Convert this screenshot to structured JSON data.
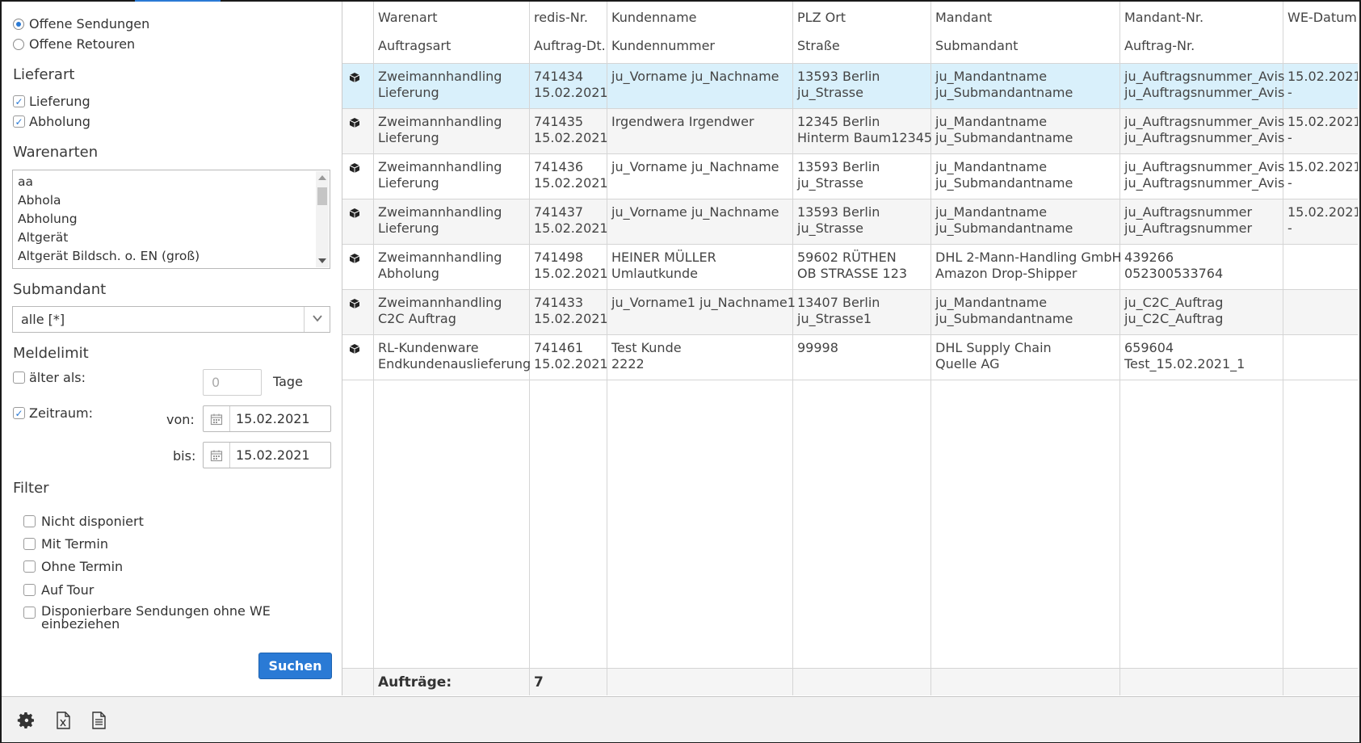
{
  "sidebar": {
    "status_options": [
      {
        "label": "Offene Sendungen",
        "selected": true
      },
      {
        "label": "Offene Retouren",
        "selected": false
      }
    ],
    "lieferart": {
      "title": "Lieferart",
      "options": [
        {
          "label": "Lieferung",
          "checked": true
        },
        {
          "label": "Abholung",
          "checked": true
        }
      ]
    },
    "warenarten": {
      "title": "Warenarten",
      "items": [
        "aa",
        "Abhola",
        "Abholung",
        "Altgerät",
        "Altgerät Bildsch. o. EN (groß)"
      ]
    },
    "submandant": {
      "title": "Submandant",
      "value": "alle [*]"
    },
    "meldelimit": {
      "title": "Meldelimit",
      "aelter_label": "älter als:",
      "aelter_checked": false,
      "days_placeholder": "0",
      "days_unit": "Tage",
      "zeitraum_label": "Zeitraum:",
      "zeitraum_checked": true,
      "von_label": "von:",
      "von_value": "15.02.2021",
      "bis_label": "bis:",
      "bis_value": "15.02.2021"
    },
    "filter": {
      "title": "Filter",
      "options": [
        {
          "label": "Nicht disponiert",
          "checked": false
        },
        {
          "label": "Mit Termin",
          "checked": false
        },
        {
          "label": "Ohne Termin",
          "checked": false
        },
        {
          "label": "Auf Tour",
          "checked": false
        },
        {
          "label": "Disponierbare Sendungen ohne WE",
          "label2": "einbeziehen",
          "checked": false
        }
      ]
    },
    "search_label": "Suchen"
  },
  "table": {
    "headers": [
      {
        "top": "Warenart",
        "bottom": "Auftragsart"
      },
      {
        "top": "redis-Nr.",
        "bottom": "Auftrag-Dt."
      },
      {
        "top": "Kundenname",
        "bottom": "Kundennummer"
      },
      {
        "top": "PLZ Ort",
        "bottom": "Straße"
      },
      {
        "top": "Mandant",
        "bottom": "Submandant"
      },
      {
        "top": "Mandant-Nr.",
        "bottom": "Auftrag-Nr."
      },
      {
        "top": "WE-Datum",
        "bottom": ""
      }
    ],
    "rows": [
      {
        "selected": true,
        "cells": [
          [
            "Zweimannhandling",
            "Lieferung"
          ],
          [
            "741434",
            "15.02.2021"
          ],
          [
            "ju_Vorname ju_Nachname",
            ""
          ],
          [
            "13593 Berlin",
            "ju_Strasse"
          ],
          [
            "ju_Mandantname",
            "ju_Submandantname"
          ],
          [
            "ju_Auftragsnummer_Avis",
            "ju_Auftragsnummer_Avis"
          ],
          [
            "15.02.2021",
            "-"
          ]
        ]
      },
      {
        "selected": false,
        "cells": [
          [
            "Zweimannhandling",
            "Lieferung"
          ],
          [
            "741435",
            "15.02.2021"
          ],
          [
            "Irgendwera Irgendwer",
            ""
          ],
          [
            "12345 Berlin",
            "Hinterm Baum12345"
          ],
          [
            "ju_Mandantname",
            "ju_Submandantname"
          ],
          [
            "ju_Auftragsnummer_Avis",
            "ju_Auftragsnummer_Avis"
          ],
          [
            "15.02.2021",
            "-"
          ]
        ]
      },
      {
        "selected": false,
        "cells": [
          [
            "Zweimannhandling",
            "Lieferung"
          ],
          [
            "741436",
            "15.02.2021"
          ],
          [
            "ju_Vorname ju_Nachname",
            ""
          ],
          [
            "13593 Berlin",
            "ju_Strasse"
          ],
          [
            "ju_Mandantname",
            "ju_Submandantname"
          ],
          [
            "ju_Auftragsnummer_Avis",
            "ju_Auftragsnummer_Avis"
          ],
          [
            "15.02.2021",
            "-"
          ]
        ]
      },
      {
        "selected": false,
        "cells": [
          [
            "Zweimannhandling",
            "Lieferung"
          ],
          [
            "741437",
            "15.02.2021"
          ],
          [
            "ju_Vorname ju_Nachname",
            ""
          ],
          [
            "13593 Berlin",
            "ju_Strasse"
          ],
          [
            "ju_Mandantname",
            "ju_Submandantname"
          ],
          [
            "ju_Auftragsnummer",
            "ju_Auftragsnummer"
          ],
          [
            "15.02.2021",
            "-"
          ]
        ]
      },
      {
        "selected": false,
        "cells": [
          [
            "Zweimannhandling",
            "Abholung"
          ],
          [
            "741498",
            "15.02.2021"
          ],
          [
            "HEINER MÜLLER",
            "Umlautkunde"
          ],
          [
            "59602 RÜTHEN",
            "OB STRASSE 123"
          ],
          [
            "DHL 2-Mann-Handling GmbH",
            "Amazon Drop-Shipper"
          ],
          [
            "439266",
            "052300533764"
          ],
          [
            "",
            ""
          ]
        ]
      },
      {
        "selected": false,
        "cells": [
          [
            "Zweimannhandling",
            "C2C Auftrag"
          ],
          [
            "741433",
            "15.02.2021"
          ],
          [
            "ju_Vorname1 ju_Nachname1",
            ""
          ],
          [
            "13407 Berlin",
            "ju_Strasse1"
          ],
          [
            "ju_Mandantname",
            "ju_Submandantname"
          ],
          [
            "ju_C2C_Auftrag",
            "ju_C2C_Auftrag"
          ],
          [
            "",
            ""
          ]
        ]
      },
      {
        "selected": false,
        "cells": [
          [
            "RL-Kundenware",
            "Endkundenauslieferung"
          ],
          [
            "741461",
            "15.02.2021"
          ],
          [
            "Test Kunde",
            "2222"
          ],
          [
            "99998",
            ""
          ],
          [
            "DHL Supply Chain",
            "Quelle AG"
          ],
          [
            "659604",
            "Test_15.02.2021_1"
          ],
          [
            "",
            ""
          ]
        ]
      }
    ],
    "footer": {
      "label": "Aufträge:",
      "count": "7"
    }
  },
  "toolbar": {
    "icons": [
      "gear-icon",
      "excel-export-icon",
      "document-icon"
    ]
  },
  "colors": {
    "accent": "#2a7ad5",
    "selected_row": "#d9f0fb",
    "alt_row": "#f5f5f5"
  }
}
